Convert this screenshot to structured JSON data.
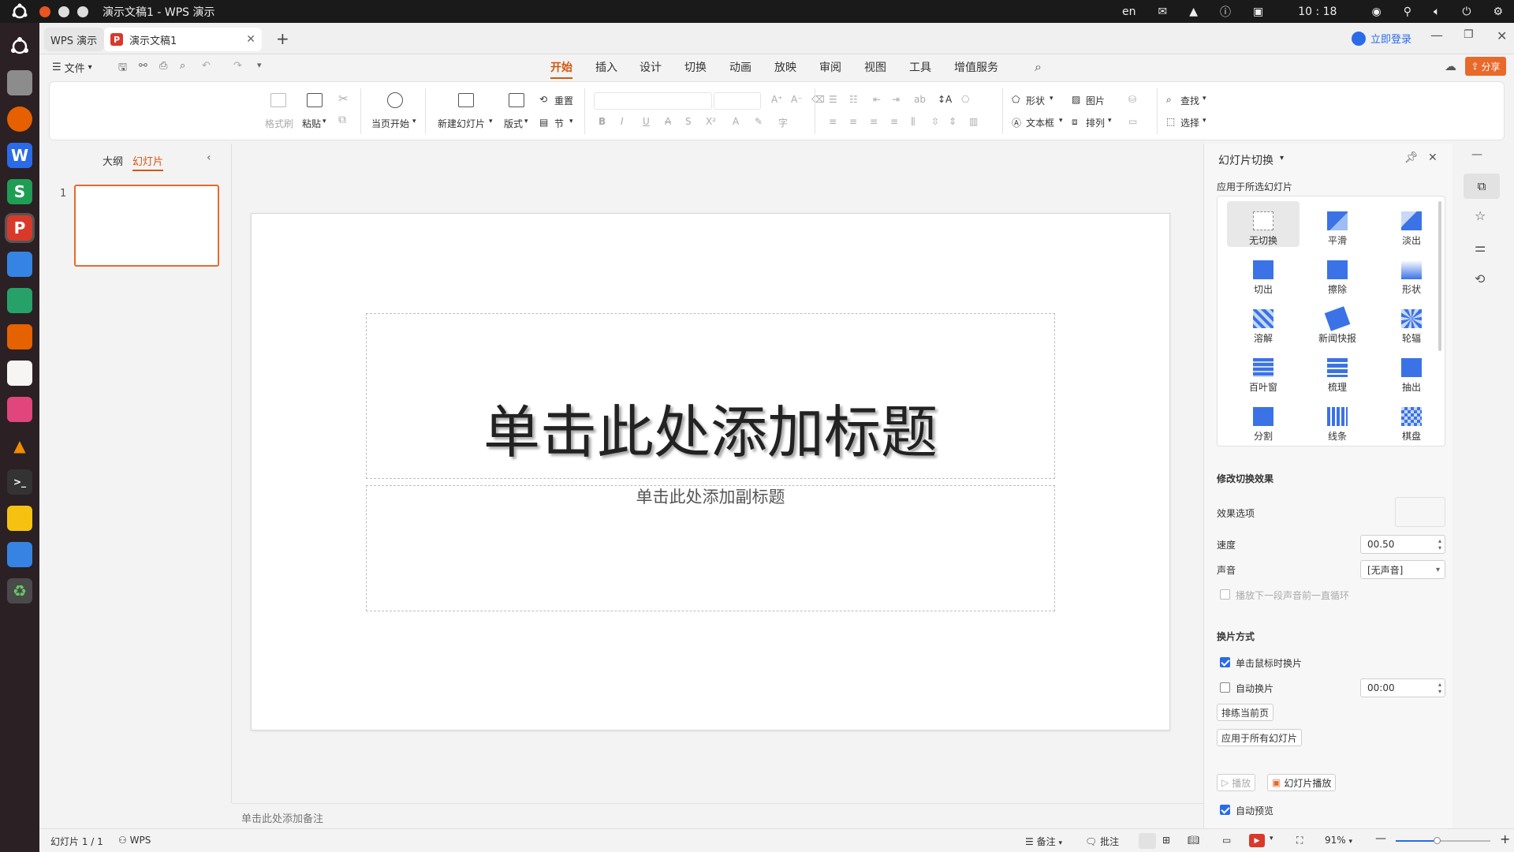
{
  "system_bar": {
    "window_title": "演示文稿1 - WPS 演示",
    "lang": "en",
    "time": "10 : 18"
  },
  "tabs": {
    "home_tab": "WPS 演示",
    "doc_tab": "演示文稿1"
  },
  "header": {
    "login": "立即登录",
    "share": "分享",
    "file_menu": "文件"
  },
  "menu_tabs": [
    "开始",
    "插入",
    "设计",
    "切换",
    "动画",
    "放映",
    "审阅",
    "视图",
    "工具",
    "增值服务"
  ],
  "ribbon": {
    "format_painter": "格式刷",
    "paste": "粘贴",
    "start_from_current": "当页开始",
    "new_slide": "新建幻灯片",
    "layout": "版式",
    "reset": "重置",
    "section": "节",
    "shape": "形状",
    "picture": "图片",
    "textbox": "文本框",
    "arrange": "排列",
    "find": "查找",
    "select": "选择"
  },
  "left_pane": {
    "outline_tab": "大纲",
    "slides_tab": "幻灯片",
    "slide_number": "1"
  },
  "slide": {
    "title_placeholder": "单击此处添加标题",
    "subtitle_placeholder": "单击此处添加副标题"
  },
  "notes_placeholder": "单击此处添加备注",
  "transition_panel": {
    "title": "幻灯片切换",
    "apply_to_selected": "应用于所选幻灯片",
    "effects": [
      {
        "label": "无切换",
        "icon": "no-transition-icon"
      },
      {
        "label": "平滑",
        "icon": "smooth-icon"
      },
      {
        "label": "淡出",
        "icon": "fade-icon"
      },
      {
        "label": "切出",
        "icon": "cut-icon"
      },
      {
        "label": "擦除",
        "icon": "wipe-icon"
      },
      {
        "label": "形状",
        "icon": "shape-icon"
      },
      {
        "label": "溶解",
        "icon": "dissolve-icon"
      },
      {
        "label": "新闻快报",
        "icon": "newsflash-icon"
      },
      {
        "label": "轮辐",
        "icon": "wheel-icon"
      },
      {
        "label": "百叶窗",
        "icon": "blinds-icon"
      },
      {
        "label": "梳理",
        "icon": "comb-icon"
      },
      {
        "label": "抽出",
        "icon": "pull-icon"
      },
      {
        "label": "分割",
        "icon": "split-icon"
      },
      {
        "label": "线条",
        "icon": "lines-icon"
      },
      {
        "label": "棋盘",
        "icon": "checkerboard-icon"
      }
    ],
    "modify_section": "修改切换效果",
    "effect_options": "效果选项",
    "speed_label": "速度",
    "speed_value": "00.50",
    "sound_label": "声音",
    "sound_value": "[无声音]",
    "loop_until_next": "播放下一段声音前一直循环",
    "advance_section": "换片方式",
    "on_click": "单击鼠标时换片",
    "auto_advance": "自动换片",
    "auto_time": "00:00",
    "rehearse": "排练当前页",
    "apply_all": "应用于所有幻灯片",
    "play": "播放",
    "slideshow": "幻灯片播放",
    "auto_preview": "自动预览"
  },
  "status_bar": {
    "slide_count": "幻灯片 1 / 1",
    "wps": "WPS",
    "notes": "备注",
    "comments": "批注",
    "zoom": "91%"
  },
  "colors": {
    "accent_orange": "#d4570f",
    "accent_blue": "#2b6be8",
    "ppt_red": "#d8392b"
  }
}
